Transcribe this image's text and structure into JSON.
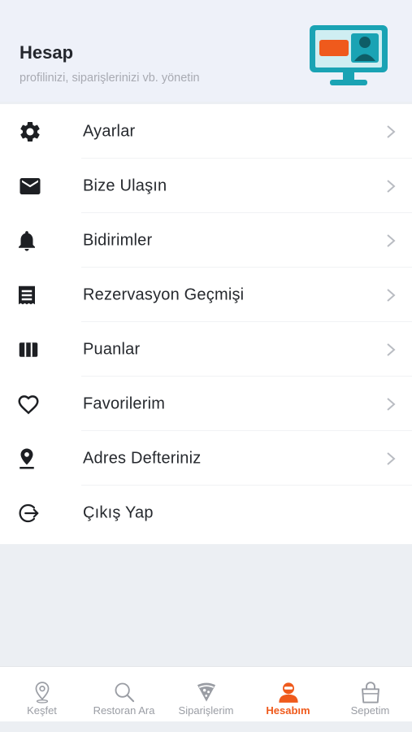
{
  "header": {
    "title": "Hesap",
    "subtitle": "profilinizi, siparişlerinizi vb. yönetin",
    "illustration_icon": "monitor-profile-icon"
  },
  "menu": {
    "items": [
      {
        "label": "Ayarlar",
        "icon": "gear-icon",
        "chevron": true
      },
      {
        "label": "Bize Ulaşın",
        "icon": "envelope-icon",
        "chevron": true
      },
      {
        "label": "Bidirimler",
        "icon": "bell-icon",
        "chevron": true
      },
      {
        "label": "Rezervasyon Geçmişi",
        "icon": "receipt-icon",
        "chevron": true
      },
      {
        "label": "Puanlar",
        "icon": "points-icon",
        "chevron": true
      },
      {
        "label": "Favorilerim",
        "icon": "heart-icon",
        "chevron": true
      },
      {
        "label": "Adres Defteriniz",
        "icon": "location-pin-icon",
        "chevron": true
      },
      {
        "label": "Çıkış Yap",
        "icon": "logout-icon",
        "chevron": false
      }
    ]
  },
  "tabbar": {
    "tabs": [
      {
        "label": "Keşfet",
        "icon": "location-pin-icon",
        "active": false
      },
      {
        "label": "Restoran Ara",
        "icon": "search-icon",
        "active": false
      },
      {
        "label": "Siparişlerim",
        "icon": "pizza-icon",
        "active": false
      },
      {
        "label": "Hesabım",
        "icon": "user-icon",
        "active": true
      },
      {
        "label": "Sepetim",
        "icon": "shopping-bag-icon",
        "active": false
      }
    ]
  },
  "colors": {
    "accent": "#ef5a1c",
    "teal": "#1aa3b4",
    "header_bg": "#eef1f9",
    "text": "#26292e",
    "muted": "#a8aab2"
  }
}
